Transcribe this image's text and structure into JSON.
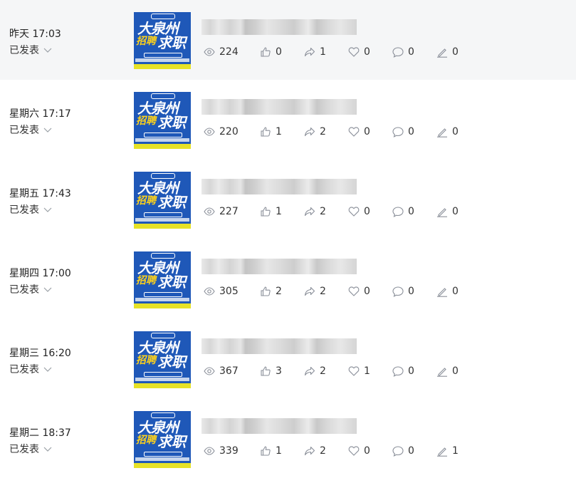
{
  "thumbnail": {
    "line1": "大泉州",
    "line2_left": "招聘",
    "line2_right": "求职"
  },
  "posts": [
    {
      "time": "昨天 17:03",
      "status": "已发表",
      "views": "224",
      "likes": "0",
      "shares": "1",
      "favorites": "0",
      "comments": "0",
      "edits": "0",
      "hover": true
    },
    {
      "time": "星期六 17:17",
      "status": "已发表",
      "views": "220",
      "likes": "1",
      "shares": "2",
      "favorites": "0",
      "comments": "0",
      "edits": "0"
    },
    {
      "time": "星期五 17:43",
      "status": "已发表",
      "views": "227",
      "likes": "1",
      "shares": "2",
      "favorites": "0",
      "comments": "0",
      "edits": "0"
    },
    {
      "time": "星期四 17:00",
      "status": "已发表",
      "views": "305",
      "likes": "2",
      "shares": "2",
      "favorites": "0",
      "comments": "0",
      "edits": "0"
    },
    {
      "time": "星期三 16:20",
      "status": "已发表",
      "views": "367",
      "likes": "3",
      "shares": "2",
      "favorites": "1",
      "comments": "0",
      "edits": "0"
    },
    {
      "time": "星期二 18:37",
      "status": "已发表",
      "views": "339",
      "likes": "1",
      "shares": "2",
      "favorites": "0",
      "comments": "0",
      "edits": "1"
    }
  ],
  "icons": {
    "status_toggle": "chevron-down-icon",
    "views": "eye-icon",
    "likes": "thumbs-up-icon",
    "shares": "share-arrow-icon",
    "favorites": "heart-icon",
    "comments": "comment-bubble-icon",
    "edits": "pen-icon"
  },
  "colors": {
    "hover_row": "#f5f6f7",
    "thumbnail_bg": "#1f58b8",
    "thumbnail_accent": "#ffd21a",
    "icon": "#8a8f99",
    "text": "#333333"
  }
}
